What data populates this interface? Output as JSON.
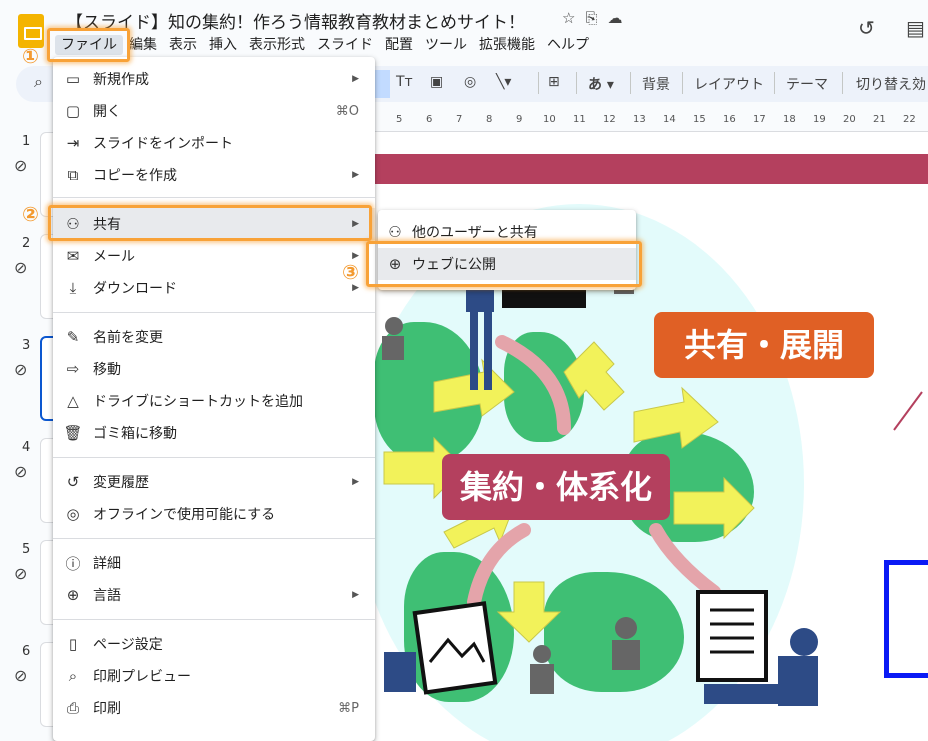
{
  "header": {
    "title": "【スライド】知の集約！作ろう情報教育教材まとめサイト！",
    "icons": [
      "star-icon",
      "move-folder-icon",
      "cloud-status-icon"
    ],
    "right_icons": [
      "history-icon",
      "comments-icon"
    ]
  },
  "menubar": [
    "ファイル",
    "編集",
    "表示",
    "挿入",
    "表示形式",
    "スライド",
    "配置",
    "ツール",
    "拡張機能",
    "ヘルプ"
  ],
  "toolbar": {
    "tt_label": "Tт",
    "aa_label": "あ",
    "background_label": "背景",
    "layout_label": "レイアウト",
    "theme_label": "テーマ",
    "transition_label": "切り替え効"
  },
  "ruler": [
    "5",
    "6",
    "7",
    "8",
    "9",
    "10",
    "11",
    "12",
    "13",
    "14",
    "15",
    "16",
    "17",
    "18",
    "19",
    "20",
    "21",
    "22"
  ],
  "filmstrip": [
    "1",
    "2",
    "3",
    "4",
    "5",
    "6"
  ],
  "file_menu": {
    "items": [
      {
        "label": "新規作成",
        "icon": "new-icon",
        "submenu": true
      },
      {
        "label": "開く",
        "icon": "folder-icon",
        "shortcut": "⌘O"
      },
      {
        "label": "スライドをインポート",
        "icon": "import-icon"
      },
      {
        "label": "コピーを作成",
        "icon": "copy-icon",
        "submenu": true
      },
      {
        "label": "共有",
        "icon": "share-person-icon",
        "submenu": true,
        "highlighted": true
      },
      {
        "label": "メール",
        "icon": "mail-icon",
        "submenu": true
      },
      {
        "label": "ダウンロード",
        "icon": "download-icon",
        "submenu": true
      },
      {
        "label": "名前を変更",
        "icon": "rename-icon"
      },
      {
        "label": "移動",
        "icon": "move-icon"
      },
      {
        "label": "ドライブにショートカットを追加",
        "icon": "drive-shortcut-icon"
      },
      {
        "label": "ゴミ箱に移動",
        "icon": "trash-icon"
      },
      {
        "label": "変更履歴",
        "icon": "history-icon",
        "submenu": true
      },
      {
        "label": "オフラインで使用可能にする",
        "icon": "offline-icon"
      },
      {
        "label": "詳細",
        "icon": "info-icon"
      },
      {
        "label": "言語",
        "icon": "globe-icon",
        "submenu": true
      },
      {
        "label": "ページ設定",
        "icon": "page-setup-icon"
      },
      {
        "label": "印刷プレビュー",
        "icon": "print-preview-icon"
      },
      {
        "label": "印刷",
        "icon": "print-icon",
        "shortcut": "⌘P"
      }
    ]
  },
  "share_menu": {
    "items": [
      {
        "label": "他のユーザーと共有",
        "icon": "share-person-icon"
      },
      {
        "label": "ウェブに公開",
        "icon": "globe-icon",
        "highlighted": true
      }
    ]
  },
  "annotations": [
    "①",
    "②",
    "③"
  ],
  "slide": {
    "badge_center": "集約・体系化",
    "badge_right": "共有・展開"
  },
  "colors": {
    "accent_orange": "#f8a238",
    "slide_red": "#b4405e",
    "slide_orange": "#e06025",
    "menu_highlight": "#e8eaed"
  }
}
